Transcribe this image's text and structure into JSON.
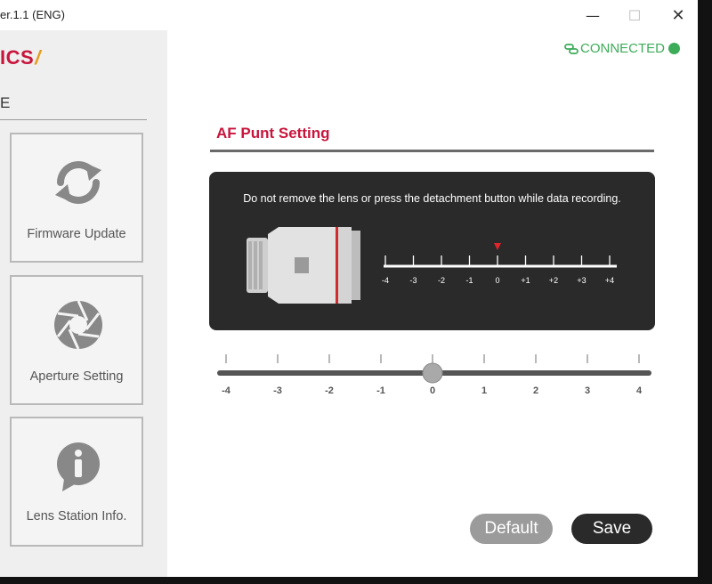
{
  "window": {
    "title": "er.1.1 (ENG)",
    "minimize_glyph": "—",
    "maximize_glyph": "☐",
    "close_glyph": "✕"
  },
  "sidebar": {
    "logo_text": "ICS",
    "logo_mark": "/",
    "heading": "E",
    "items": [
      {
        "label": "Firmware Update",
        "icon": "refresh-icon"
      },
      {
        "label": "Aperture Setting",
        "icon": "aperture-icon"
      },
      {
        "label": "Lens Station Info.",
        "icon": "info-icon"
      }
    ]
  },
  "status": {
    "label": "CONNECTED",
    "icon": "link-icon",
    "color": "#3dac59"
  },
  "main": {
    "section_title": "AF Punt Setting",
    "notice": "Do not remove the lens or press the detachment button while data recording.",
    "lens_scale": {
      "ticks": [
        "-4",
        "-3",
        "-2",
        "-1",
        "0",
        "+1",
        "+2",
        "+3",
        "+4"
      ],
      "marker_value": 0,
      "marker_color": "#e0252b"
    },
    "slider": {
      "ticks": [
        "-4",
        "-3",
        "-2",
        "-1",
        "0",
        "1",
        "2",
        "3",
        "4"
      ],
      "min": -4,
      "max": 4,
      "value": 0
    }
  },
  "buttons": {
    "default_label": "Default",
    "save_label": "Save"
  },
  "colors": {
    "accent": "#c8153c",
    "panel": "#2a2a2a",
    "connected": "#3dac59"
  }
}
